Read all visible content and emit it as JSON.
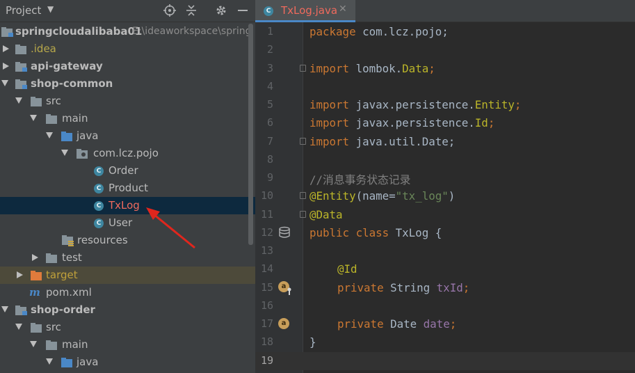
{
  "project_panel": {
    "title": "Project",
    "tree": [
      {
        "label": "springcloudalibaba01",
        "path": "E:\\ideaworkspace\\spring"
      },
      {
        "label": ".idea"
      },
      {
        "label": "api-gateway"
      },
      {
        "label": "shop-common"
      },
      {
        "label": "src"
      },
      {
        "label": "main"
      },
      {
        "label": "java"
      },
      {
        "label": "com.lcz.pojo"
      },
      {
        "label": "Order"
      },
      {
        "label": "Product"
      },
      {
        "label": "TxLog"
      },
      {
        "label": "User"
      },
      {
        "label": "resources"
      },
      {
        "label": "test"
      },
      {
        "label": "target"
      },
      {
        "label": "pom.xml"
      },
      {
        "label": "shop-order"
      },
      {
        "label": "src"
      },
      {
        "label": "main"
      },
      {
        "label": "java"
      }
    ]
  },
  "editor": {
    "tab_label": "TxLog.java",
    "line_numbers": [
      "1",
      "2",
      "3",
      "4",
      "5",
      "6",
      "7",
      "8",
      "9",
      "10",
      "11",
      "12",
      "13",
      "14",
      "15",
      "16",
      "17",
      "18",
      "19"
    ],
    "code": {
      "l1_kw": "package",
      "l1_rest": " com.lcz.pojo;",
      "l3_kw": "import",
      "l3_a": " lombok.",
      "l3_b": "Data",
      "l3_c": ";",
      "l5_kw": "import",
      "l5_a": " javax.persistence.",
      "l5_b": "Entity",
      "l5_c": ";",
      "l6_kw": "import",
      "l6_a": " javax.persistence.",
      "l6_b": "Id",
      "l6_c": ";",
      "l7_kw": "import",
      "l7_a": " java.util.Date;",
      "l9": "//消息事务状态记录",
      "l10_ann": "@Entity",
      "l10_a": "(",
      "l10_b": "name",
      "l10_c": "=",
      "l10_str": "\"tx_log\"",
      "l10_d": ")",
      "l11_ann": "@Data",
      "l12_kw": "public class",
      "l12_rest": " TxLog {",
      "l14_ann": "@Id",
      "l15_kw": "private",
      "l15_a": " String ",
      "l15_fld": "txId",
      "l15_c": ";",
      "l17_kw": "private",
      "l17_a": " Date ",
      "l17_fld": "date",
      "l17_c": ";",
      "l18": "}"
    },
    "gutter_badge": "a"
  },
  "colors": {
    "keyword": "#cc7832",
    "annotation": "#bbb529",
    "string": "#6a8759",
    "field": "#9876aa",
    "selection": "#0d293e",
    "class_badge": "#3e86a0"
  }
}
